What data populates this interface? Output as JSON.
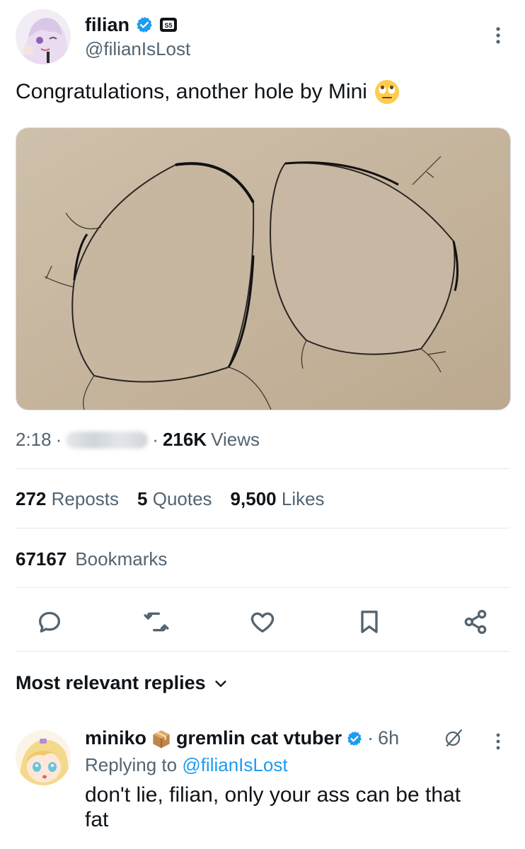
{
  "tweet": {
    "author_name": "filian",
    "author_handle": "@filianIsLost",
    "text": "Congratulations, another hole by Mini",
    "emoji": "face-with-rolling-eyes",
    "time": "2:18",
    "dot": "·",
    "views_count": "216K",
    "views_label": "Views"
  },
  "stats": {
    "reposts_count": "272",
    "reposts_label": "Reposts",
    "quotes_count": "5",
    "quotes_label": "Quotes",
    "likes_count": "9,500",
    "likes_label": "Likes",
    "bookmarks_count": "67167",
    "bookmarks_label": "Bookmarks"
  },
  "actions": [
    "reply-icon",
    "repost-icon",
    "like-icon",
    "bookmark-icon",
    "share-icon"
  ],
  "replies": {
    "section_title": "Most relevant replies",
    "items": [
      {
        "name_part1": "miniko",
        "name_part2": "gremlin cat vtuber",
        "dot": "·",
        "time": "6h",
        "replying_prefix": "Replying to",
        "replying_handle": "@filianIsLost",
        "text": "don't lie, filian, only your ass can be that fat"
      }
    ]
  },
  "colors": {
    "verified": "#1d9bf0",
    "muted_text": "#536471",
    "text": "#0f1419",
    "divider": "#e6e9ec",
    "wall": "#c9b9a5"
  }
}
